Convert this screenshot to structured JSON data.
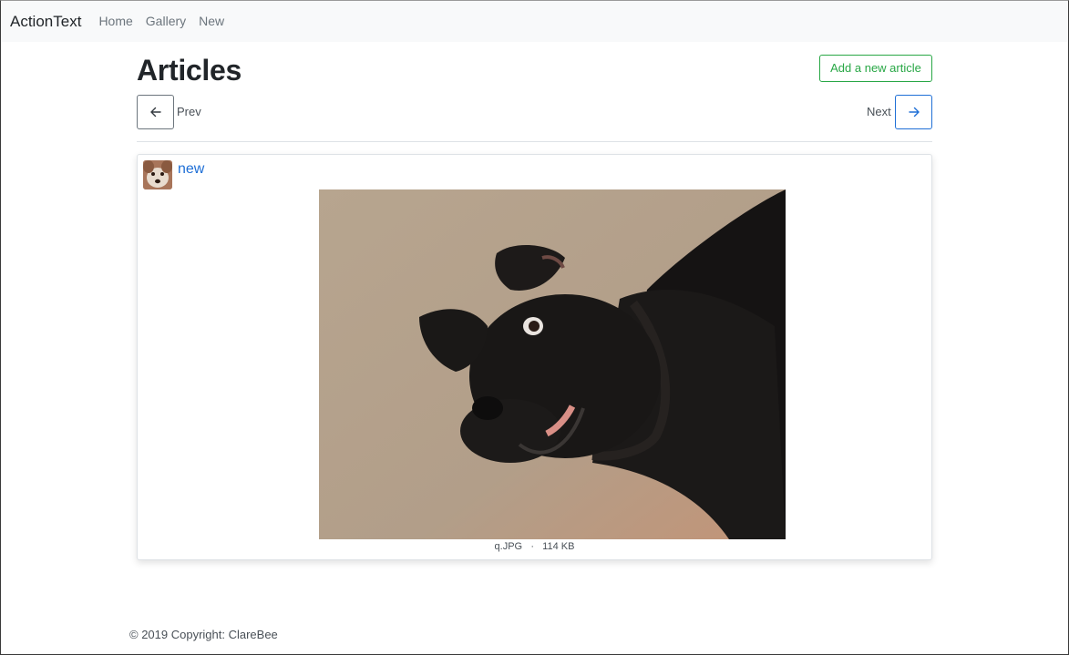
{
  "navbar": {
    "brand": "ActionText",
    "links": [
      "Home",
      "Gallery",
      "New"
    ]
  },
  "page": {
    "title": "Articles",
    "add_button_label": "Add a new article"
  },
  "pager": {
    "prev_label": "Prev",
    "next_label": "Next",
    "prev_icon": "arrow-left-icon",
    "next_icon": "arrow-right-icon"
  },
  "article": {
    "title": "new",
    "attachment": {
      "filename": "q.JPG",
      "separator": "·",
      "size": "114 KB"
    }
  },
  "footer": {
    "copyright": "© 2019 Copyright: ClareBee"
  },
  "colors": {
    "navbar_bg": "#f8f9fa",
    "success": "#28a745",
    "primary": "#1f6fd6",
    "secondary": "#6c757d"
  }
}
